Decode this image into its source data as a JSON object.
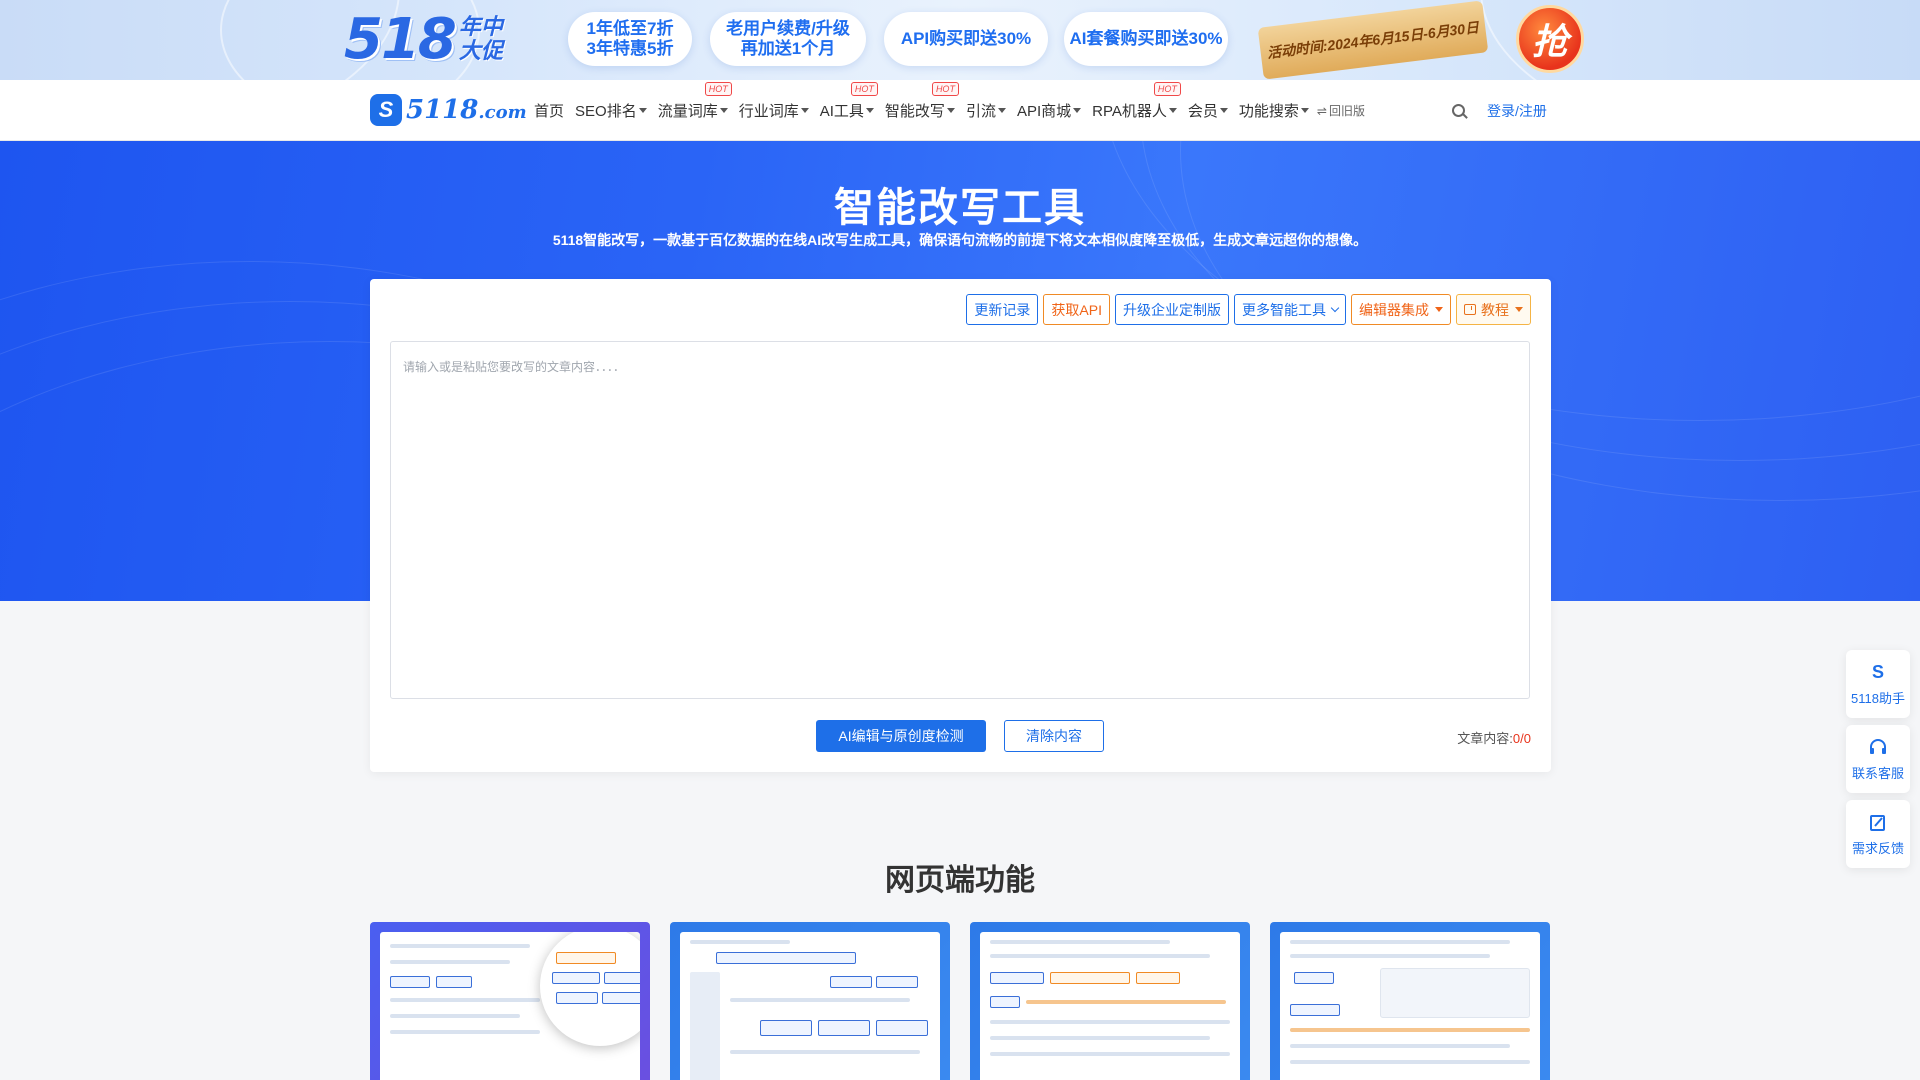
{
  "promo": {
    "logo_number": "518",
    "logo_sub_1": "年中",
    "logo_sub_2": "大促",
    "pills": [
      "1年低至7折\n3年特惠5折",
      "老用户续费/升级\n再加送1个月",
      "API购买即送30%",
      "AI套餐购买即送30%"
    ],
    "ribbon": "活动时间:2024年6月15日-6月30日",
    "grab": "抢"
  },
  "nav": {
    "logo_mark": "S",
    "logo_text": "5118",
    "logo_domain": ".com",
    "items": [
      {
        "label": "首页",
        "caret": false,
        "hot": false
      },
      {
        "label": "SEO排名",
        "caret": true,
        "hot": false
      },
      {
        "label": "流量词库",
        "caret": true,
        "hot": true
      },
      {
        "label": "行业词库",
        "caret": true,
        "hot": false
      },
      {
        "label": "AI工具",
        "caret": true,
        "hot": true
      },
      {
        "label": "智能改写",
        "caret": true,
        "hot": true
      },
      {
        "label": "引流",
        "caret": true,
        "hot": false
      },
      {
        "label": "API商城",
        "caret": true,
        "hot": false
      },
      {
        "label": "RPA机器人",
        "caret": true,
        "hot": true
      },
      {
        "label": "会员",
        "caret": true,
        "hot": false
      },
      {
        "label": "功能搜索",
        "caret": true,
        "hot": false
      }
    ],
    "hot_label": "HOT",
    "old_version_symbol": "⇌",
    "old_version": "回旧版",
    "login": "登录/注册"
  },
  "hero": {
    "title": "智能改写工具",
    "subtitle": "5118智能改写，一款基于百亿数据的在线AI改写生成工具，确保语句流畅的前提下将文本相似度降至极低，生成文章远超你的想像。"
  },
  "toolbar": {
    "changelog": "更新记录",
    "get_api": "获取API",
    "enterprise": "升级企业定制版",
    "more_tools": "更多智能工具",
    "editor_integration": "编辑器集成",
    "tutorial": "教程"
  },
  "editor": {
    "placeholder": "请输入或是粘贴您要改写的文章内容．．．．",
    "value": ""
  },
  "actions": {
    "detect": "AI编辑与原创度检测",
    "clear": "清除内容",
    "count_label": "文章内容:",
    "count_value": "0/0"
  },
  "features": {
    "title": "网页端功能"
  },
  "float_bar": {
    "assistant": "5118助手",
    "support": "联系客服",
    "feedback": "需求反馈"
  },
  "colors": {
    "primary": "#1e6fe8",
    "hero": "#2a64f6",
    "accent_orange": "#f06418",
    "hot_red": "#f04848"
  }
}
